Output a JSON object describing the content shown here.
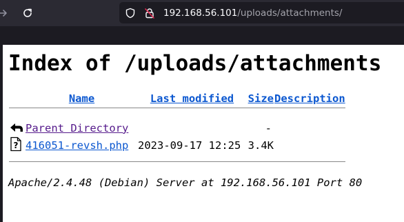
{
  "browser": {
    "url_host": "192.168.56.101",
    "url_path": "/uploads/attachments/",
    "back_icon": "arrow-right-icon",
    "reload_icon": "reload-icon",
    "tracking_icon": "shield-icon",
    "security_icon": "insecure-lock-icon"
  },
  "page": {
    "title": "Index of /uploads/attachments",
    "columns": {
      "name": "Name",
      "last_modified": "Last modified",
      "size": "Size",
      "description": "Description"
    },
    "rows": [
      {
        "icon": "back-arrow-icon",
        "name": "Parent Directory",
        "last_modified": "",
        "size": "-",
        "description": ""
      },
      {
        "icon": "unknown-file-icon",
        "name": "416051-revsh.php",
        "last_modified": "2023-09-17 12:25",
        "size": "3.4K",
        "description": ""
      }
    ],
    "footer": "Apache/2.4.48 (Debian) Server at 192.168.56.101 Port 80"
  }
}
